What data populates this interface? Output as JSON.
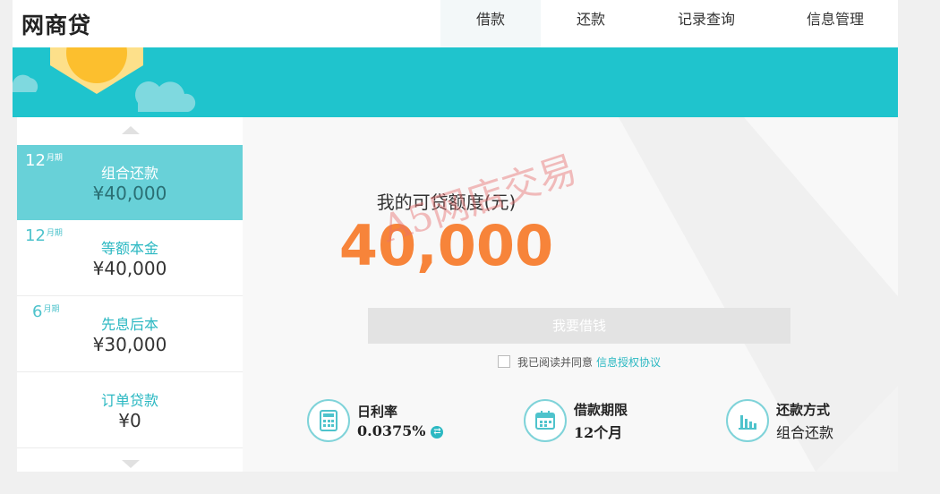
{
  "header": {
    "logo": "网商贷",
    "nav": [
      {
        "label": "借款",
        "active": true
      },
      {
        "label": "还款",
        "active": false
      },
      {
        "label": "记录查询",
        "active": false
      },
      {
        "label": "信息管理",
        "active": false
      }
    ]
  },
  "sidebar": {
    "plans": [
      {
        "term_number": "12",
        "term_unit": "月期",
        "name": "组合还款",
        "amount": "¥40,000",
        "active": true
      },
      {
        "term_number": "12",
        "term_unit": "月期",
        "name": "等额本金",
        "amount": "¥40,000",
        "active": false
      },
      {
        "term_number": "6",
        "term_unit": "月期",
        "name": "先息后本",
        "amount": "¥30,000",
        "active": false
      },
      {
        "term_number": "",
        "term_unit": "",
        "name": "订单贷款",
        "amount": "¥0",
        "active": false
      }
    ]
  },
  "main": {
    "quota_label": "我的可贷额度(元)",
    "quota_value": "40,000",
    "watermark": "A5网店交易",
    "borrow_button": "我要借钱",
    "agreement_text": "我已阅读并同意",
    "agreement_link": "信息授权协议",
    "info": {
      "rate_label": "日利率",
      "rate_value": "0.0375%",
      "term_label": "借款期限",
      "term_value": "12个月",
      "method_label": "还款方式",
      "method_value": "组合还款"
    }
  },
  "colors": {
    "accent": "#1fc4cd",
    "active_plan": "#68d1d8",
    "amount_orange": "#f7843a"
  }
}
